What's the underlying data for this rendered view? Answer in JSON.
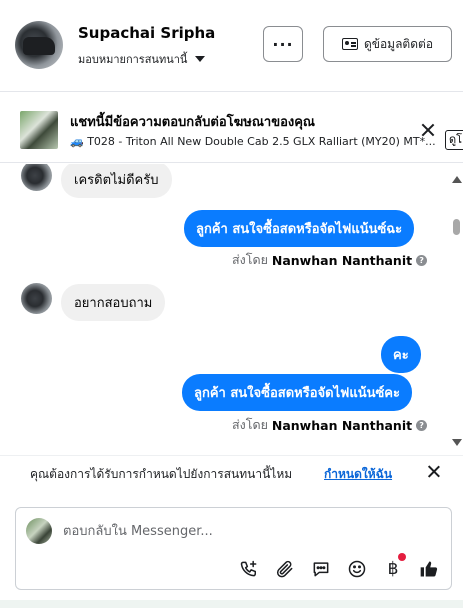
{
  "header": {
    "contact_name": "Supachai Sripha",
    "assign_label": "มอบหมายการสนทนานี้",
    "more_label": "···",
    "info_button_label": "ดูข้อมูลติดต่อ"
  },
  "ad_banner": {
    "title": "แชทนี้มีข้อความตอบกลับต่อโฆษณาของคุณ",
    "vehicle_emoji": "🚙",
    "subtitle": "T028 - Triton All New Double Cab 2.5 GLX Ralliart (MY20) MT*...",
    "view_button_label": "ดูโ"
  },
  "messages": [
    {
      "direction": "in",
      "text": "เครดิตไม่ดีครับ"
    },
    {
      "direction": "out",
      "text": "ลูกค้า  สนใจซื้อสดหรือจัดไฟแน้นซ์ฉะ"
    },
    {
      "direction": "meta",
      "prefix": "ส่งโดย",
      "sender": "Nanwhan Nanthanit"
    },
    {
      "direction": "in",
      "text": "อยากสอบถาม"
    },
    {
      "direction": "out",
      "text": "คะ"
    },
    {
      "direction": "out",
      "text": "ลูกค้า  สนใจซื้อสดหรือจัดไฟแน้นซ์คะ"
    },
    {
      "direction": "meta",
      "prefix": "ส่งโดย",
      "sender": "Nanwhan Nanthanit"
    }
  ],
  "reminder": {
    "text": "คุณต้องการได้รับการกำหนดไปยังการสนทนานี้ไหม",
    "link_label": "กำหนดให้ฉัน"
  },
  "composer": {
    "placeholder": "ตอบกลับใน Messenger..."
  },
  "toolbar": {
    "icons": [
      "phone-add-icon",
      "paperclip-icon",
      "chat-reply-icon",
      "emoji-icon",
      "baht-icon",
      "thumbs-up-icon"
    ]
  },
  "colors": {
    "accent_blue": "#0a7cff",
    "link_blue": "#0a66d8",
    "incoming_bubble": "#f0f0f0",
    "notification_red": "#e41e3f"
  }
}
